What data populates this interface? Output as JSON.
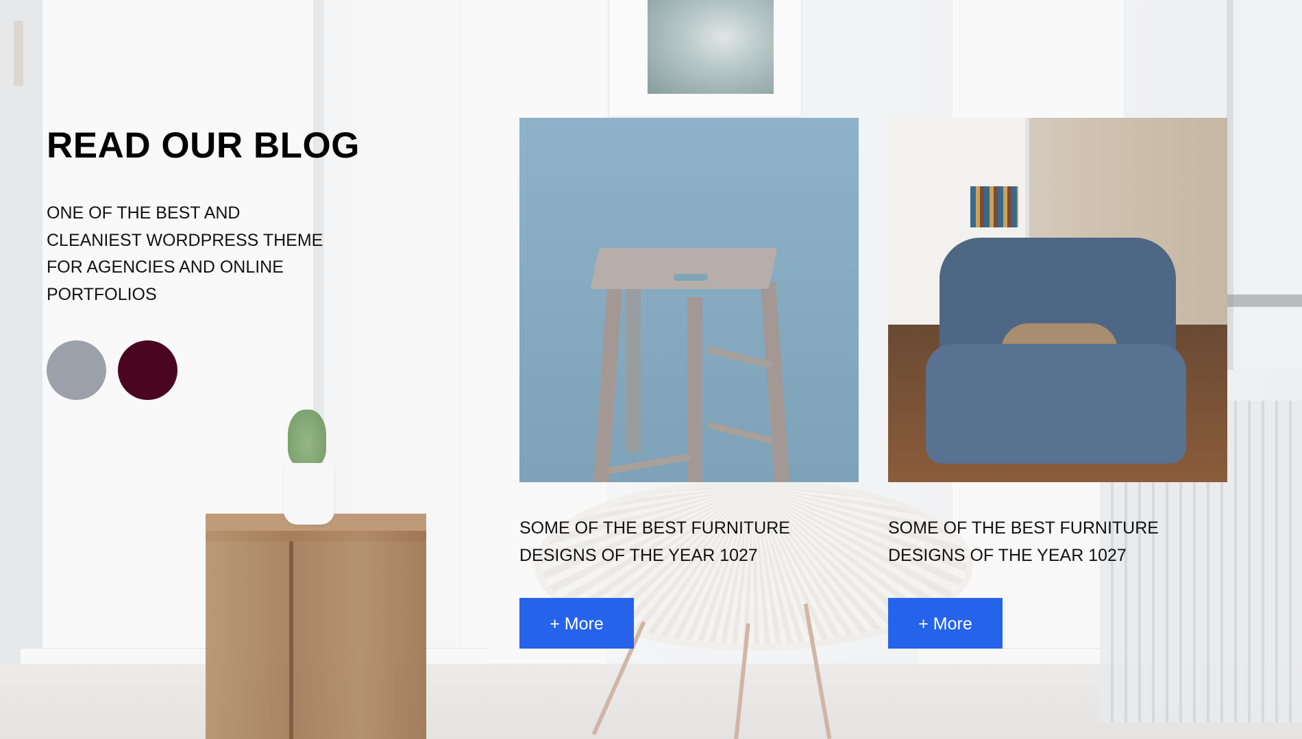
{
  "section": {
    "title": "READ OUR BLOG",
    "subtitle": "ONE OF THE BEST AND CLEANIEST WORDPRESS THEME FOR AGENCIES AND ONLINE PORTFOLIOS",
    "swatches": [
      {
        "name": "gray",
        "color": "#9ca0aa"
      },
      {
        "name": "wine",
        "color": "#4a0620"
      }
    ]
  },
  "cards": [
    {
      "title": "SOME OF THE BEST FURNITURE DESIGNS OF THE YEAR 1027",
      "button_label": "+ More"
    },
    {
      "title": "SOME OF THE BEST FURNITURE DESIGNS OF THE YEAR 1027",
      "button_label": "+ More"
    }
  ],
  "colors": {
    "accent": "#2563eb",
    "text": "#111111"
  }
}
